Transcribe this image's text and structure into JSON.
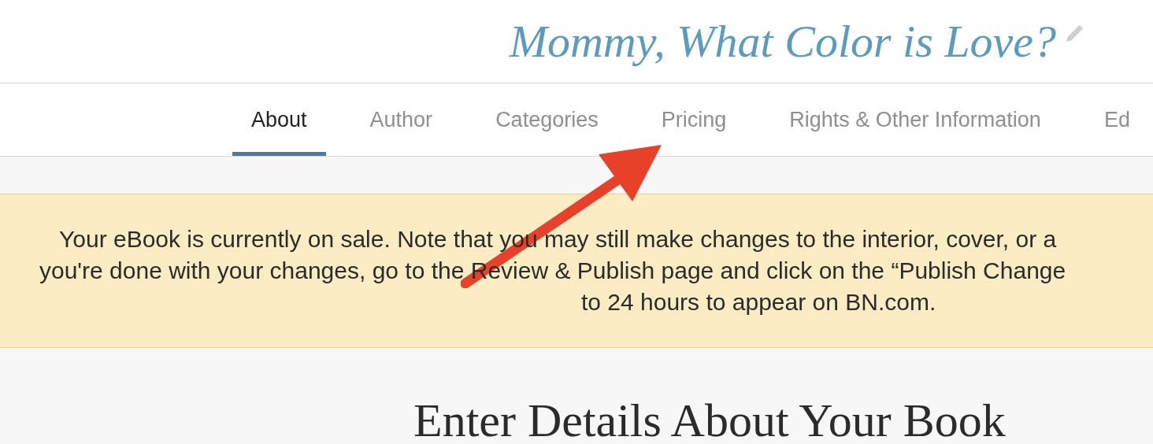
{
  "header": {
    "title": "Mommy, What Color is Love?"
  },
  "tabs": [
    {
      "label": "About",
      "selected": true
    },
    {
      "label": "Author",
      "selected": false
    },
    {
      "label": "Categories",
      "selected": false
    },
    {
      "label": "Pricing",
      "selected": false
    },
    {
      "label": "Rights & Other Information",
      "selected": false
    },
    {
      "label": "Ed",
      "selected": false
    }
  ],
  "notice": {
    "lines": [
      "Your eBook is currently on sale. Note that you may still make changes to the interior, cover, or a",
      "you're done with your changes, go to the Review & Publish page and click on the “Publish Change",
      "to 24 hours to appear on BN.com."
    ]
  },
  "section": {
    "heading": "Enter Details About Your Book"
  }
}
